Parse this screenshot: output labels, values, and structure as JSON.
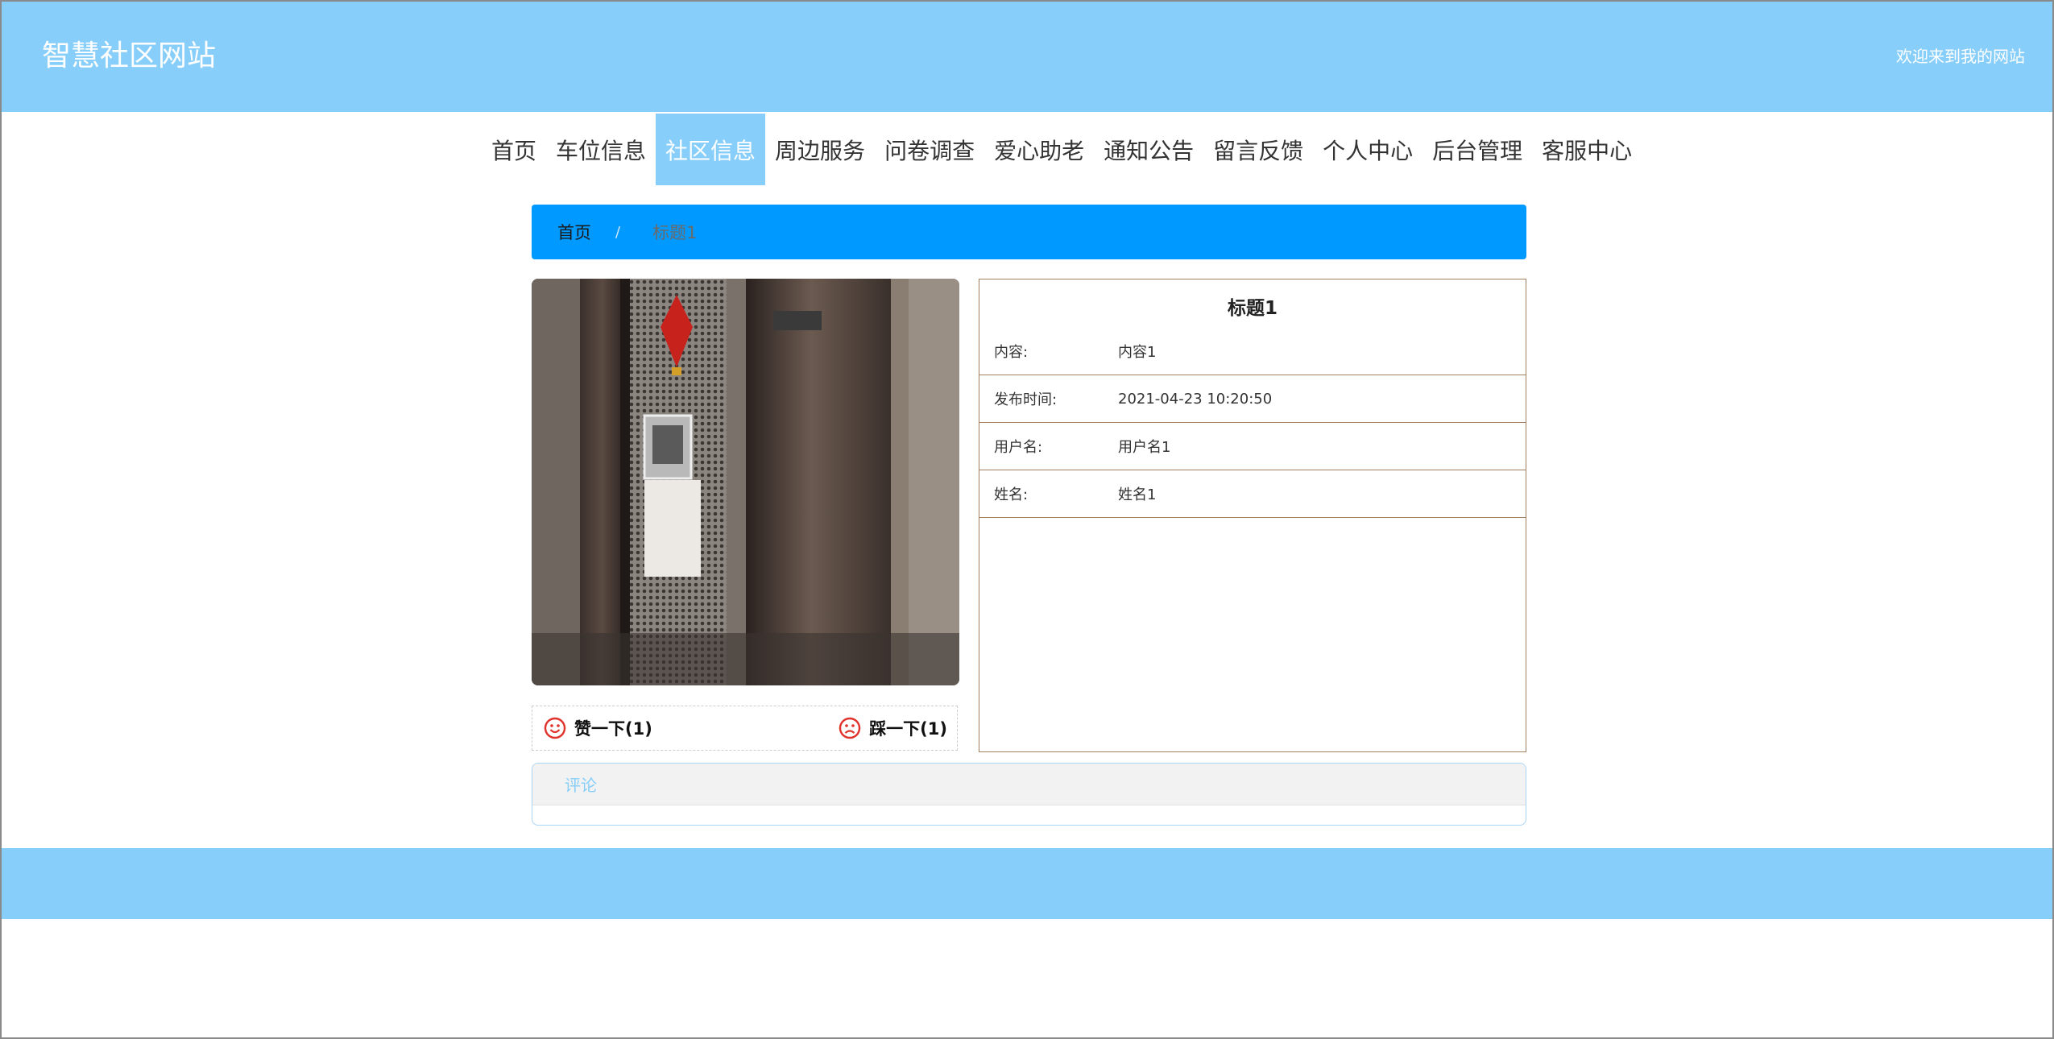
{
  "header": {
    "site_title": "智慧社区网站",
    "welcome": "欢迎来到我的网站"
  },
  "nav": {
    "items": [
      {
        "label": "首页"
      },
      {
        "label": "车位信息"
      },
      {
        "label": "社区信息"
      },
      {
        "label": "周边服务"
      },
      {
        "label": "问卷调查"
      },
      {
        "label": "爱心助老"
      },
      {
        "label": "通知公告"
      },
      {
        "label": "留言反馈"
      },
      {
        "label": "个人中心"
      },
      {
        "label": "后台管理"
      },
      {
        "label": "客服中心"
      }
    ],
    "active": "社区信息"
  },
  "breadcrumb": {
    "home": "首页",
    "separator": "/",
    "current": "标题1"
  },
  "detail": {
    "title": "标题1",
    "fields": [
      {
        "label": "内容:",
        "value": "内容1"
      },
      {
        "label": "发布时间:",
        "value": "2021-04-23 10:20:50"
      },
      {
        "label": "用户名:",
        "value": "用户名1"
      },
      {
        "label": "姓名:",
        "value": "姓名1"
      }
    ]
  },
  "votes": {
    "like_label": "赞一下(1)",
    "dislike_label": "踩一下(1)"
  },
  "comments": {
    "header": "评论"
  },
  "colors": {
    "header_bg": "#87cefa",
    "breadcrumb_bg": "#0099ff",
    "vote_icon": "#e0312a"
  }
}
